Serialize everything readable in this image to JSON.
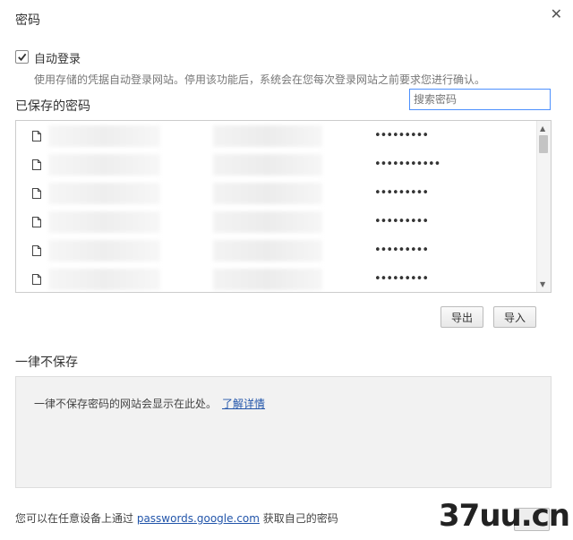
{
  "dialog": {
    "title": "密码"
  },
  "autologin": {
    "checked": true,
    "label": "自动登录",
    "hint": "使用存储的凭据自动登录网站。停用该功能后，系统会在您每次登录网站之前要求您进行确认。"
  },
  "saved": {
    "title": "已保存的密码",
    "search_placeholder": "搜索密码",
    "rows": [
      {
        "password": "•••••••••"
      },
      {
        "password": "•••••••••••"
      },
      {
        "password": "•••••••••"
      },
      {
        "password": "•••••••••"
      },
      {
        "password": "•••••••••"
      },
      {
        "password": "•••••••••"
      }
    ]
  },
  "buttons": {
    "export": "导出",
    "import": "导入"
  },
  "never_save": {
    "title": "一律不保存",
    "text": "一律不保存密码的网站会显示在此处。",
    "link": "了解详情"
  },
  "footer": {
    "prefix": "您可以在任意设备上通过 ",
    "link": "passwords.google.com",
    "suffix": " 获取自己的密码"
  },
  "watermark": "37uu.cn",
  "colors": {
    "link": "#2255aa",
    "focus": "#4d90fe",
    "panel": "#f2f2f2"
  },
  "icons": {
    "close": "close-icon",
    "row": "document-icon",
    "checkbox": "check-icon"
  }
}
